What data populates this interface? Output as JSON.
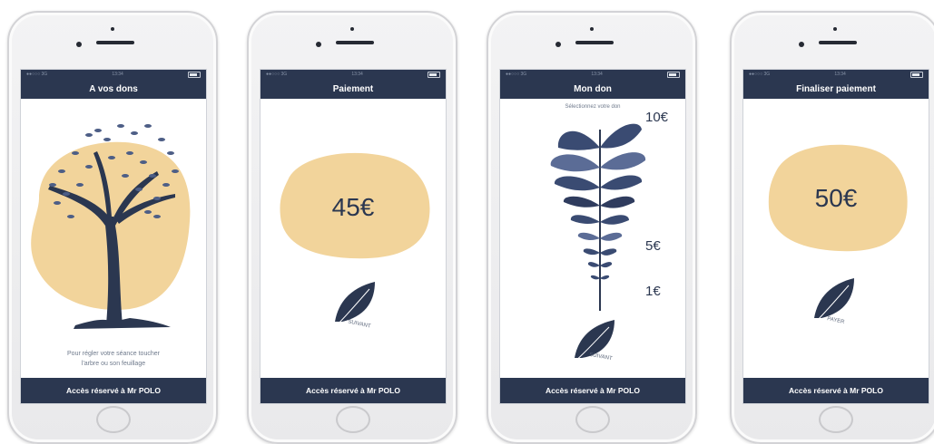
{
  "screens": [
    {
      "status": {
        "carrier": "●●○○○ 3G",
        "time": "13:34"
      },
      "title": "A vos dons",
      "instruction_line1": "Pour régler votre séance toucher",
      "instruction_line2": "l'arbre ou son feuillage",
      "footer": "Accès réservé à Mr POLO"
    },
    {
      "status": {
        "carrier": "●●○○○ 3G",
        "time": "13:34"
      },
      "title": "Paiement",
      "amount": "45€",
      "leaf_label": "SUIVANT",
      "footer": "Accès réservé à Mr POLO"
    },
    {
      "status": {
        "carrier": "●●○○○ 3G",
        "time": "13:34"
      },
      "title": "Mon don",
      "instruction": "Sélectionnez votre don",
      "values": [
        "10€",
        "5€",
        "1€"
      ],
      "leaf_label": "SUIVANT",
      "footer": "Accès réservé à Mr POLO"
    },
    {
      "status": {
        "carrier": "●●○○○ 3G",
        "time": "13:34"
      },
      "title": "Finaliser paiement",
      "amount": "50€",
      "leaf_label": "PAYER",
      "footer": "Accès réservé à Mr POLO"
    }
  ],
  "colors": {
    "navy": "#2b3750",
    "sand": "#f2d49b",
    "leaf": "#3a4b72"
  }
}
